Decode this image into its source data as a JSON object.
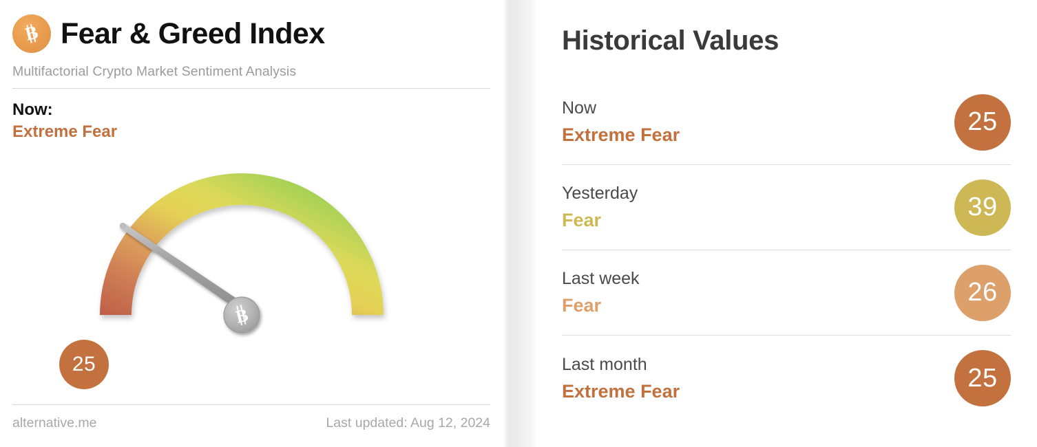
{
  "left": {
    "logo_icon": "bitcoin-icon",
    "title": "Fear & Greed Index",
    "subtitle": "Multifactorial Crypto Market Sentiment Analysis",
    "now_label": "Now:",
    "now_value": "Extreme Fear",
    "now_value_color": "#c2703e",
    "gauge_bubble_value": "25",
    "gauge_bubble_color": "#c2713f",
    "footer_source": "alternative.me",
    "footer_updated": "Last updated: Aug 12, 2024"
  },
  "right": {
    "title": "Historical Values",
    "rows": [
      {
        "period": "Now",
        "classification": "Extreme Fear",
        "value": "25",
        "color": "#c2713f"
      },
      {
        "period": "Yesterday",
        "classification": "Fear",
        "value": "39",
        "color": "#ceb856"
      },
      {
        "period": "Last week",
        "classification": "Fear",
        "value": "26",
        "color": "#dda06a"
      },
      {
        "period": "Last month",
        "classification": "Extreme Fear",
        "value": "25",
        "color": "#c2713f"
      }
    ]
  },
  "chart_data": {
    "type": "gauge",
    "title": "Fear & Greed Index",
    "subtitle": "Multifactorial Crypto Market Sentiment Analysis",
    "value": 25,
    "label": "Extreme Fear",
    "range": [
      0,
      100
    ],
    "start_angle_deg": 180,
    "end_angle_deg": 0,
    "needle_angle_deg": 135,
    "arc_gradient_stops": [
      "#c0614a",
      "#d98f5c",
      "#e3d855",
      "#b8d055",
      "#6fc94a"
    ],
    "hub_icon": "bitcoin-icon",
    "series": [
      {
        "name": "Now",
        "value": 25,
        "classification": "Extreme Fear"
      },
      {
        "name": "Yesterday",
        "value": 39,
        "classification": "Fear"
      },
      {
        "name": "Last week",
        "value": 26,
        "classification": "Fear"
      },
      {
        "name": "Last month",
        "value": 25,
        "classification": "Extreme Fear"
      }
    ]
  }
}
